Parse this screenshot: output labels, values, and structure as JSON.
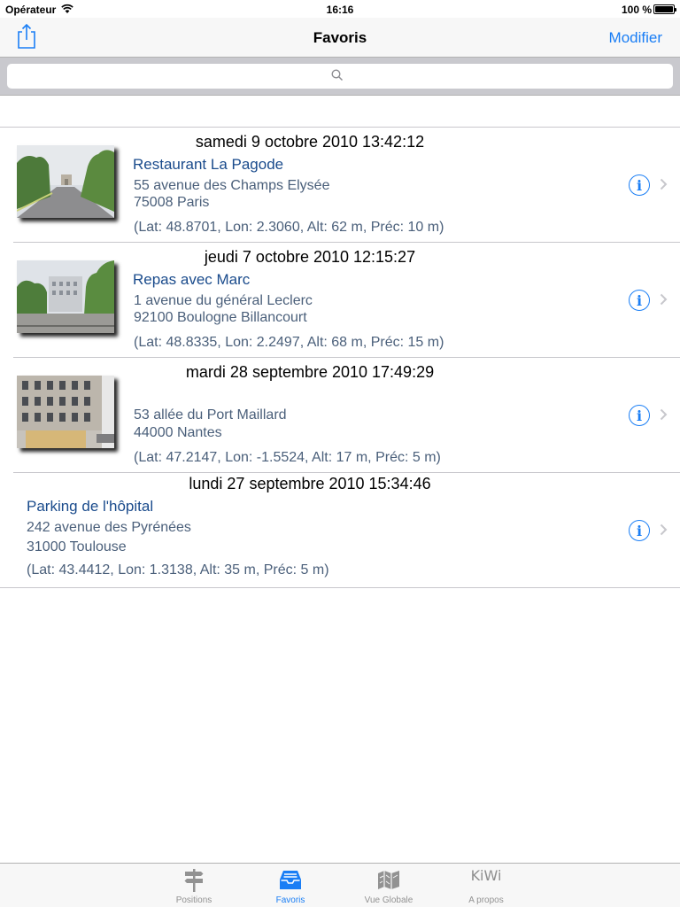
{
  "status": {
    "carrier": "Opérateur",
    "time": "16:16",
    "battery": "100 %"
  },
  "nav": {
    "title": "Favoris",
    "edit_label": "Modifier"
  },
  "search": {
    "placeholder": ""
  },
  "favorites": [
    {
      "date": "samedi 9 octobre 2010 13:42:12",
      "title": "Restaurant La Pagode",
      "address_line1": "55 avenue des Champs Elysée",
      "address_line2": "75008 Paris",
      "coords": "(Lat: 48.8701, Lon: 2.3060, Alt: 62 m, Préc: 10 m)",
      "thumbnail": "photo-champs-elysees"
    },
    {
      "date": "jeudi 7 octobre 2010 12:15:27",
      "title": "Repas avec Marc",
      "address_line1": "1 avenue du général Leclerc",
      "address_line2": "92100 Boulogne Billancourt",
      "coords": "(Lat: 48.8335, Lon: 2.2497, Alt: 68 m, Préc: 15 m)",
      "thumbnail": "photo-boulogne-square"
    },
    {
      "date": "mardi 28 septembre 2010 17:49:29",
      "title": "",
      "address_line1": "53 allée du Port Maillard",
      "address_line2": "44000 Nantes",
      "coords": "(Lat: 47.2147, Lon: -1.5524, Alt: 17 m, Préc: 5 m)",
      "thumbnail": "photo-nantes-building"
    },
    {
      "date": "lundi 27 septembre 2010 15:34:46",
      "title": "Parking de l'hôpital",
      "address_line1": "242 avenue des Pyrénées",
      "address_line2": "31000 Toulouse",
      "coords": "(Lat: 43.4412, Lon: 1.3138, Alt: 35 m, Préc: 5 m)",
      "thumbnail": ""
    }
  ],
  "tabs": [
    {
      "label": "Positions",
      "icon": "signpost-icon",
      "active": false
    },
    {
      "label": "Favoris",
      "icon": "inbox-tray-icon",
      "active": true
    },
    {
      "label": "Vue Globale",
      "icon": "map-icon",
      "active": false
    },
    {
      "label": "A propos",
      "icon": "kiwi-logo-icon",
      "logo_text": "KiWi",
      "active": false
    }
  ],
  "colors": {
    "accent": "#1a7ef5",
    "title_text": "#1a4b8c",
    "detail_text": "#4a5f7a",
    "tab_inactive": "#929292"
  }
}
